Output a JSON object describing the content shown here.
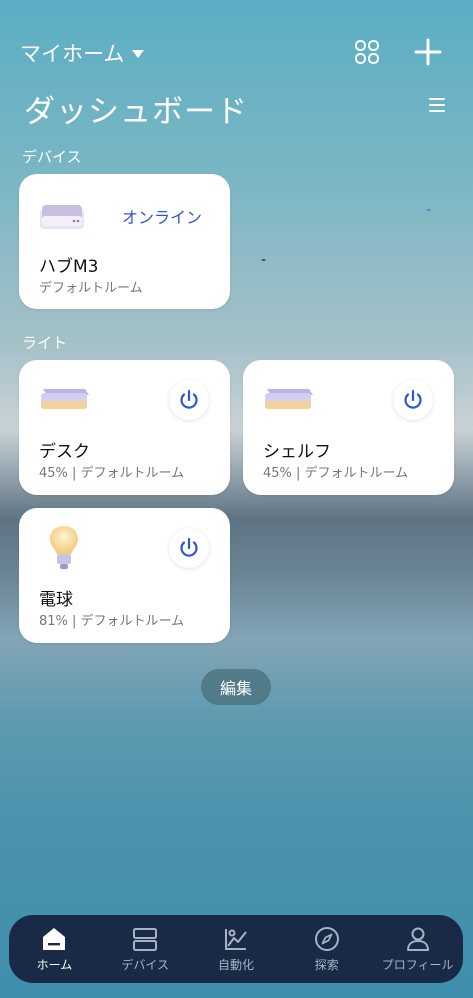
{
  "header": {
    "home_name": "マイホーム",
    "title": "ダッシュボード"
  },
  "sections": {
    "devices_label": "デバイス",
    "lights_label": "ライト"
  },
  "hub": {
    "name": "ハブM3",
    "room": "デフォルトルーム",
    "status": "オンライン"
  },
  "lights": [
    {
      "name": "デスク",
      "detail": "45% | デフォルトルーム",
      "brightness_percent": 45
    },
    {
      "name": "シェルフ",
      "detail": "45% | デフォルトルーム",
      "brightness_percent": 45
    },
    {
      "name": "電球",
      "detail": "81% | デフォルトルーム",
      "brightness_percent": 81
    }
  ],
  "edit_label": "編集",
  "stray_marks": [
    "-",
    "-"
  ],
  "nav": {
    "items": [
      {
        "label": "ホーム",
        "icon": "home-icon",
        "active": true
      },
      {
        "label": "デバイス",
        "icon": "devices-icon",
        "active": false
      },
      {
        "label": "自動化",
        "icon": "automation-icon",
        "active": false
      },
      {
        "label": "探索",
        "icon": "compass-icon",
        "active": false
      },
      {
        "label": "プロフィール",
        "icon": "profile-icon",
        "active": false
      }
    ]
  },
  "colors": {
    "accent": "#2e55d4",
    "nav_bg": "#182a46"
  }
}
